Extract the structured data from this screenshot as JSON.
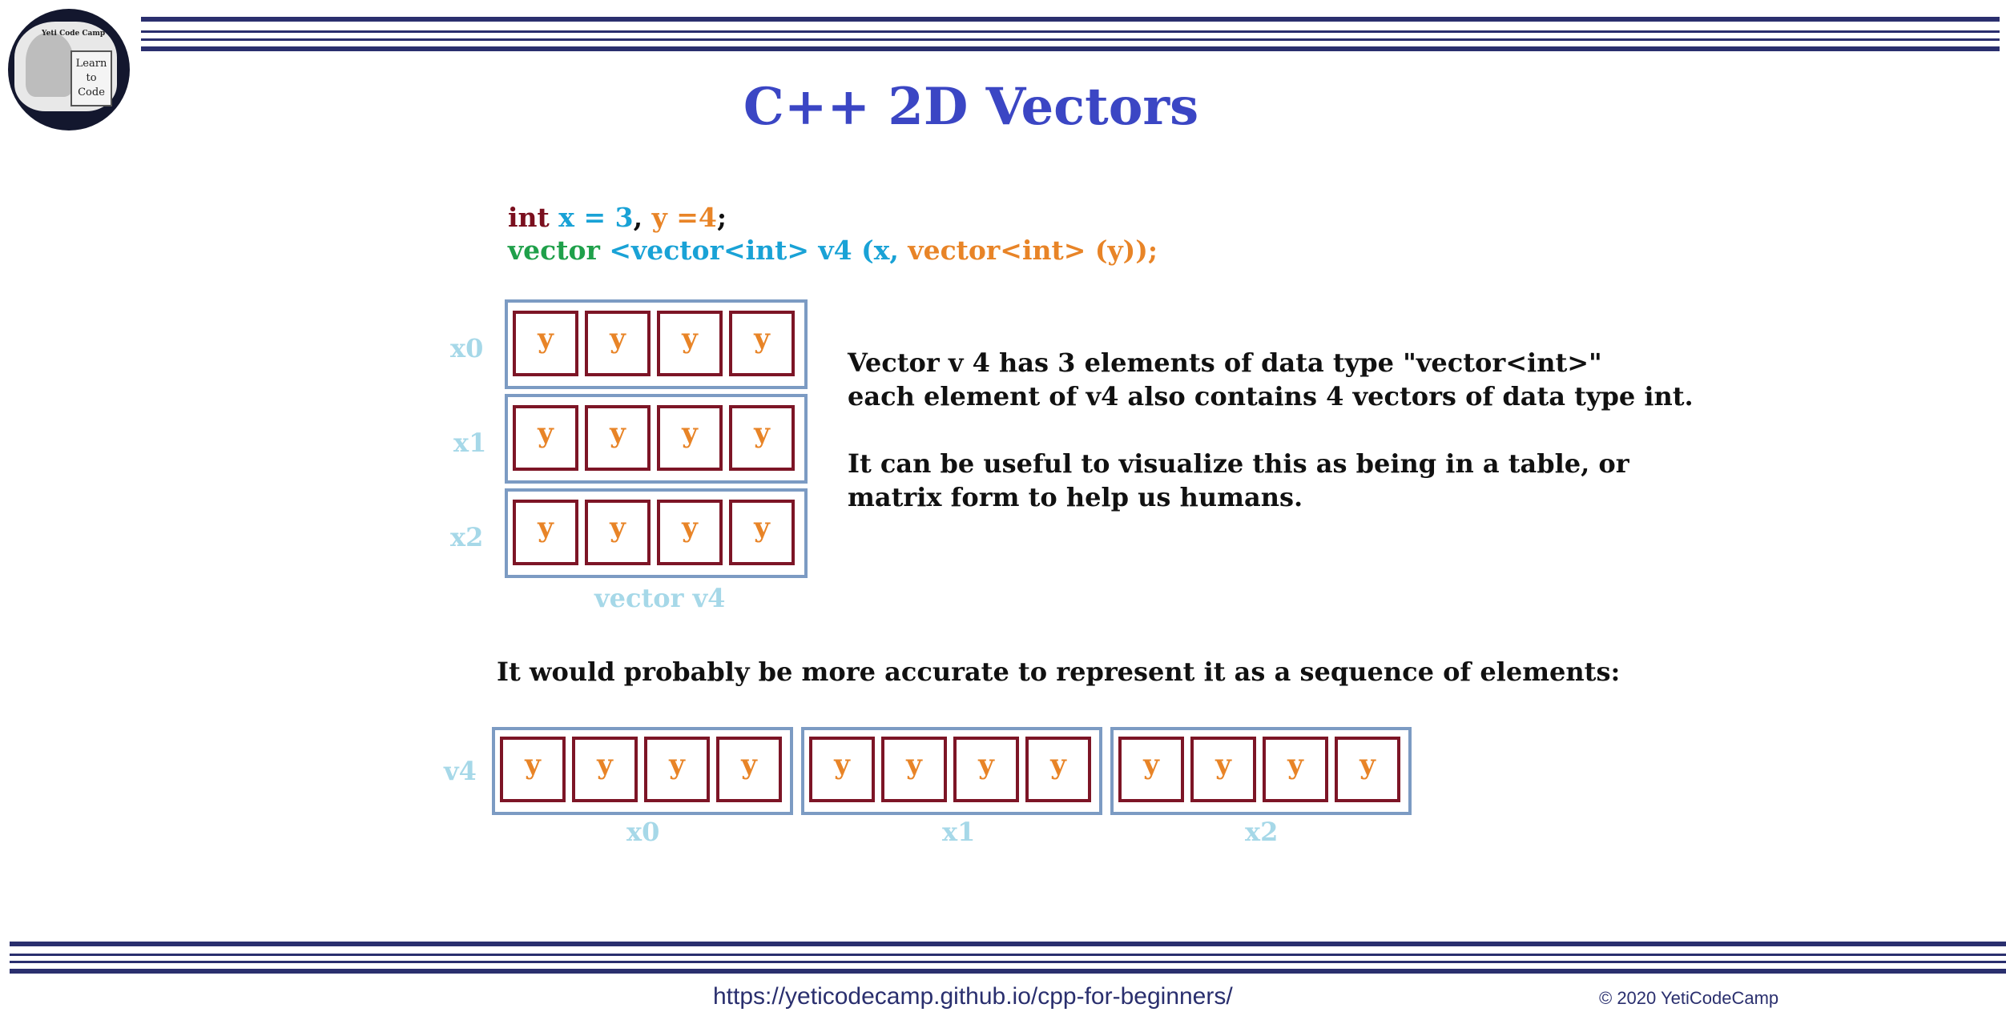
{
  "logo": {
    "brand": "Yeti Code Camp",
    "sign_lines": [
      "Learn",
      "to",
      "Code"
    ]
  },
  "title": "C++ 2D Vectors",
  "code": {
    "line1": {
      "kw": "int",
      "x": "x",
      "eq1": " = ",
      "xv": "3",
      "comma": ", ",
      "y": "y =4",
      "semi": ";"
    },
    "line2": {
      "kw": "vector",
      "inner": " <vector<int> v4 (x, ",
      "vec": "vector<int> (y));",
      "tail": ""
    }
  },
  "matrix": {
    "rows": [
      {
        "label": "x0",
        "cells": [
          "y",
          "y",
          "y",
          "y"
        ]
      },
      {
        "label": "x1",
        "cells": [
          "y",
          "y",
          "y",
          "y"
        ]
      },
      {
        "label": "x2",
        "cells": [
          "y",
          "y",
          "y",
          "y"
        ]
      }
    ],
    "caption": "vector v4"
  },
  "description": {
    "line1": "Vector v 4 has 3 elements of data type \"vector<int>\"",
    "line2": "each element of v4 also contains 4 vectors of data type int.",
    "line3": "It can be useful to visualize this as being in a table, or",
    "line4": "matrix form to help us humans."
  },
  "sequence": {
    "heading": "It would probably be more accurate to represent it as a sequence of elements:",
    "label": "v4",
    "groups": [
      {
        "label": "x0",
        "cells": [
          "y",
          "y",
          "y",
          "y"
        ]
      },
      {
        "label": "x1",
        "cells": [
          "y",
          "y",
          "y",
          "y"
        ]
      },
      {
        "label": "x2",
        "cells": [
          "y",
          "y",
          "y",
          "y"
        ]
      }
    ]
  },
  "footer": {
    "url": "https://yeticodecamp.github.io/cpp-for-beginners/",
    "copyright": "© 2020 YetiCodeCamp"
  },
  "colors": {
    "title": "#3b46c4",
    "rule": "#2a2f6e",
    "cell_border": "#7d1526",
    "row_border": "#7c9bc3",
    "label": "#a6d8e8",
    "y_text": "#e88427"
  }
}
